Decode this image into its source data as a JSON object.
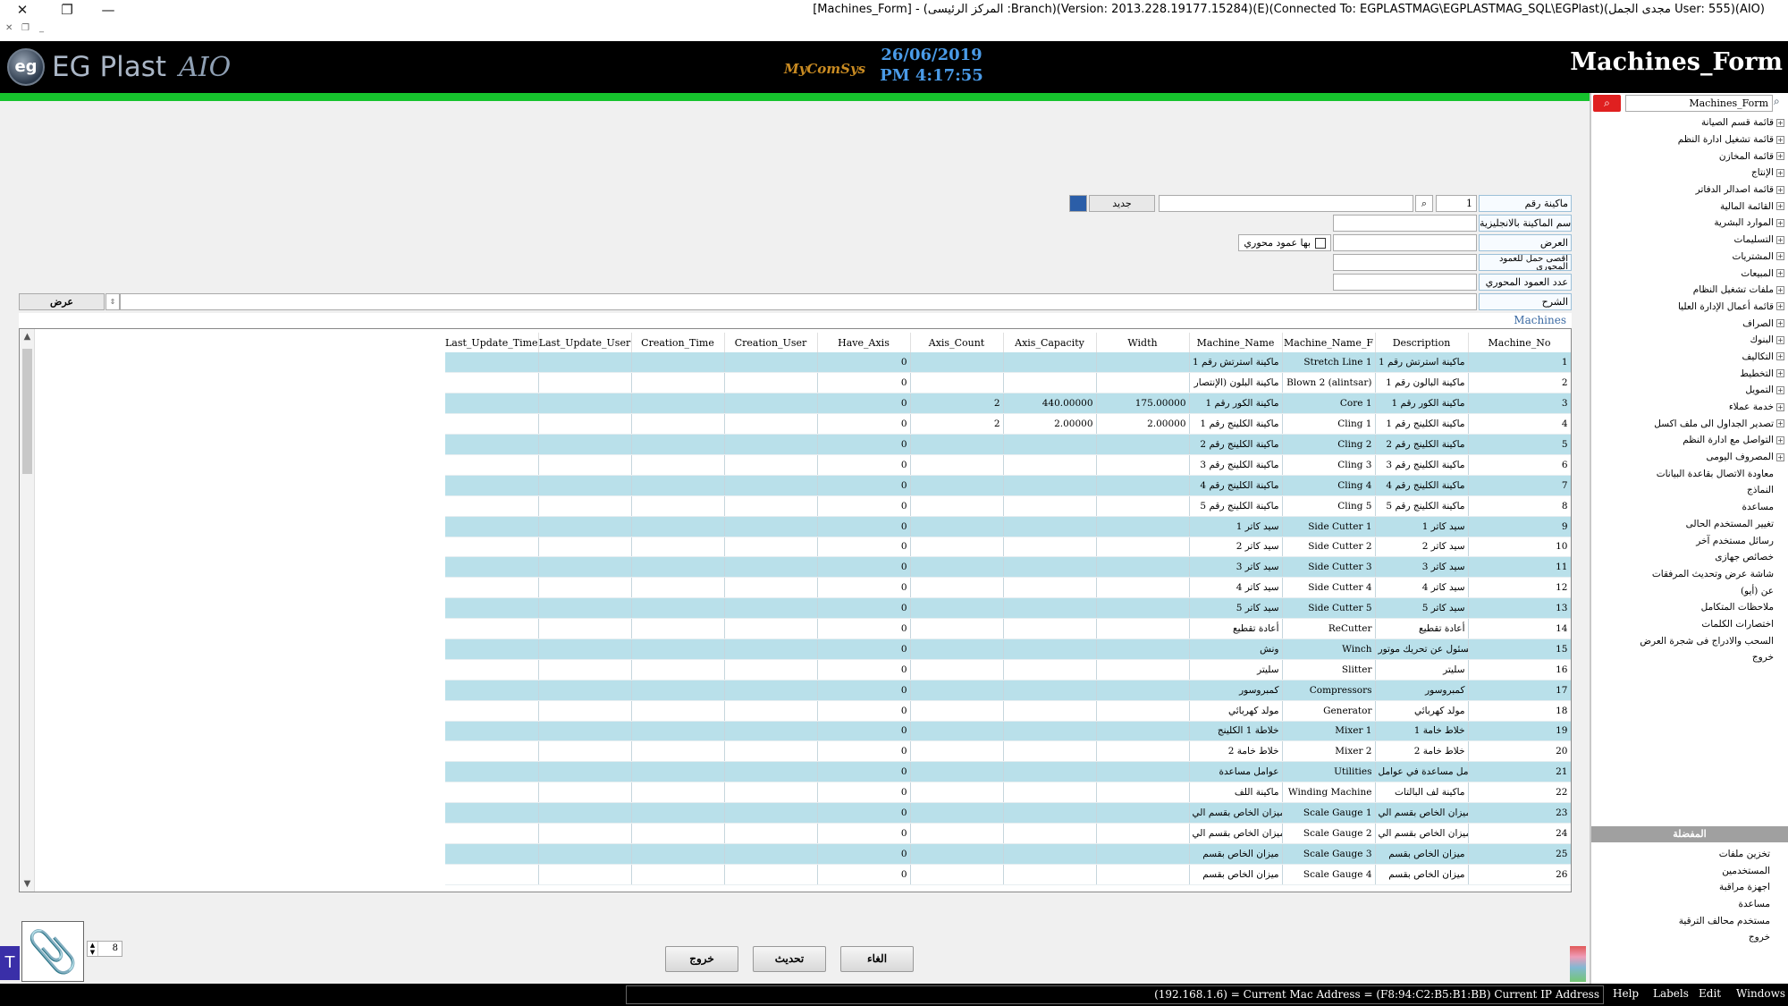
{
  "window": {
    "title": "[Machines_Form] - (المركز الرئيسى :Branch)(Version: 2013.228.19177.15284)(E)(Connected To: EGPLASTMAG\\EGPLASTMAG_SQL\\EGPlast)(مجدى الجمل User: 555)(AIO)",
    "close_glyph": "✕",
    "restore_glyph": "❐",
    "minimize_glyph": "—"
  },
  "header": {
    "logo_text": "EG Plast",
    "logo_script": "AIO",
    "brand_mid": "MyComSys",
    "date": "26/06/2019",
    "time": "PM 4:17:55",
    "form_title": "Machines_Form"
  },
  "sidebar": {
    "search_value": "Machines_Form",
    "items": [
      {
        "label": "قائمة قسم الصيانة",
        "plus": true
      },
      {
        "label": "قائمة تشغيل ادارة النظم",
        "plus": true
      },
      {
        "label": "قائمة المخازن",
        "plus": true
      },
      {
        "label": "الإنتاج",
        "plus": true
      },
      {
        "label": "قائمة اصدالر الدفاتر",
        "plus": true
      },
      {
        "label": "القائمة المالية",
        "plus": true
      },
      {
        "label": "الموارد البشرية",
        "plus": true
      },
      {
        "label": "التسليمات",
        "plus": true
      },
      {
        "label": "المشتريات",
        "plus": true
      },
      {
        "label": "المبيعات",
        "plus": true
      },
      {
        "label": "ملفات تشغيل النظام",
        "plus": true
      },
      {
        "label": "قائمة أعمال الإدارة العليا",
        "plus": true
      },
      {
        "label": "الصراف",
        "plus": true
      },
      {
        "label": "البنوك",
        "plus": true
      },
      {
        "label": "التكاليف",
        "plus": true
      },
      {
        "label": "التخطيط",
        "plus": true
      },
      {
        "label": "التمويل",
        "plus": true
      },
      {
        "label": "خدمة عملاء",
        "plus": true
      },
      {
        "label": "تصدير الجداول الى ملف اكسل",
        "plus": true
      },
      {
        "label": "التواصل مع ادارة النظم",
        "plus": true
      },
      {
        "label": "المصروف اليومى",
        "plus": true
      },
      {
        "label": "معاودة الاتصال بقاعدة البيانات",
        "plus": false
      },
      {
        "label": "النماذج",
        "plus": false
      },
      {
        "label": "مساعدة",
        "plus": false
      },
      {
        "label": "تغيير المستخدم الحالى",
        "plus": false
      },
      {
        "label": "رسائل مستخدم آخر",
        "plus": false
      },
      {
        "label": "خصائص جهازى",
        "plus": false
      },
      {
        "label": "شاشة عرض وتحديث المرفقات",
        "plus": false
      },
      {
        "label": "عن (أيو)",
        "plus": false
      },
      {
        "label": "ملاحظات المتكامل",
        "plus": false
      },
      {
        "label": "اختصارات الكلمات",
        "plus": false
      },
      {
        "label": "السحب والادراج فى شجرة العرض",
        "plus": false
      },
      {
        "label": "خروج",
        "plus": false
      }
    ],
    "sub_header": "المفضلة",
    "sub_items": [
      "تخزين ملفات",
      "المستخدمين",
      "اجهزة مراقبة",
      "مساعدة",
      "مستخدم محالف الترقية",
      "خروج"
    ]
  },
  "form": {
    "machine_no_label": "ماكينة رقم",
    "machine_no_value": "1",
    "new_button": "جديد",
    "name_en_label": "اسم الماكينة بالانجليزية",
    "width_label": "العرض",
    "has_axis_label": "بها عمود محوري",
    "axis_capacity_label": "أقصى حمل للعمود المحورى",
    "axis_count_label": "عدد العمود المحوري",
    "description_label": "الشرح",
    "view_button": "عرض"
  },
  "grid": {
    "title": "Machines",
    "columns": [
      "Last_Update_Time",
      "Last_Update_User",
      "Creation_Time",
      "Creation_User",
      "Have_Axis",
      "Axis_Count",
      "Axis_Capacity",
      "Width",
      "Machine_Name",
      "Machine_Name_F",
      "Description",
      "Machine_No"
    ],
    "rows": [
      [
        "",
        "",
        "",
        "",
        "0",
        "",
        "",
        "",
        "ماكينة استرتش رقم 1",
        "Stretch Line 1",
        "ماكينة استرتش رقم 1",
        "1"
      ],
      [
        "",
        "",
        "",
        "",
        "0",
        "",
        "",
        "",
        "ماكينة البلون (الإنتصار",
        "Blown 2 (alintsar)",
        "ماكينة البالون رقم 1",
        "2"
      ],
      [
        "",
        "",
        "",
        "",
        "0",
        "2",
        "440.00000",
        "175.00000",
        "ماكينة الكور رقم 1",
        "Core 1",
        "ماكينة الكور رقم 1",
        "3"
      ],
      [
        "",
        "",
        "",
        "",
        "0",
        "2",
        "2.00000",
        "2.00000",
        "ماكينة الكلينج رقم 1",
        "Cling 1",
        "ماكينة الكلينج رقم 1",
        "4"
      ],
      [
        "",
        "",
        "",
        "",
        "0",
        "",
        "",
        "",
        "ماكينة الكلينج رقم 2",
        "Cling 2",
        "ماكينة الكلينج رقم 2",
        "5"
      ],
      [
        "",
        "",
        "",
        "",
        "0",
        "",
        "",
        "",
        "ماكينة الكلينج رقم 3",
        "Cling 3",
        "ماكينة الكلينج رقم 3",
        "6"
      ],
      [
        "",
        "",
        "",
        "",
        "0",
        "",
        "",
        "",
        "ماكينة الكلينج رقم 4",
        "Cling 4",
        "ماكينة الكلينج رقم 4",
        "7"
      ],
      [
        "",
        "",
        "",
        "",
        "0",
        "",
        "",
        "",
        "ماكينة الكلينج رقم 5",
        "Cling 5",
        "ماكينة الكلينج رقم 5",
        "8"
      ],
      [
        "",
        "",
        "",
        "",
        "0",
        "",
        "",
        "",
        "سيد كاتر 1",
        "Side Cutter 1",
        "سيد كاتر 1",
        "9"
      ],
      [
        "",
        "",
        "",
        "",
        "0",
        "",
        "",
        "",
        "سيد كاتر 2",
        "Side Cutter 2",
        "سيد كاتر 2",
        "10"
      ],
      [
        "",
        "",
        "",
        "",
        "0",
        "",
        "",
        "",
        "سيد كاتر 3",
        "Side Cutter 3",
        "سيد كاتر 3",
        "11"
      ],
      [
        "",
        "",
        "",
        "",
        "0",
        "",
        "",
        "",
        "سيد كاتر 4",
        "Side Cutter 4",
        "سيد كاتر 4",
        "12"
      ],
      [
        "",
        "",
        "",
        "",
        "0",
        "",
        "",
        "",
        "سيد كاتر 5",
        "Side Cutter 5",
        "سيد كاتر 5",
        "13"
      ],
      [
        "",
        "",
        "",
        "",
        "0",
        "",
        "",
        "",
        "أعادة تقطيع",
        "ReCutter",
        "أعادة تقطيع",
        "14"
      ],
      [
        "",
        "",
        "",
        "",
        "0",
        "",
        "",
        "",
        "ونش",
        "Winch",
        "مسئول عن تحريك موتور",
        "15"
      ],
      [
        "",
        "",
        "",
        "",
        "0",
        "",
        "",
        "",
        "سليتر",
        "Slitter",
        "سليتر",
        "16"
      ],
      [
        "",
        "",
        "",
        "",
        "0",
        "",
        "",
        "",
        "كمبروسور",
        "Compressors",
        "كمبروسور",
        "17"
      ],
      [
        "",
        "",
        "",
        "",
        "0",
        "",
        "",
        "",
        "مولد كهربائي",
        "Generator",
        "مولد كهربائي",
        "18"
      ],
      [
        "",
        "",
        "",
        "",
        "0",
        "",
        "",
        "",
        "خلاطة 1 الكلينج",
        "Mixer 1",
        "خلاط خامة 1",
        "19"
      ],
      [
        "",
        "",
        "",
        "",
        "0",
        "",
        "",
        "",
        "خلاط خامة 2",
        "Mixer 2",
        "خلاط خامة 2",
        "20"
      ],
      [
        "",
        "",
        "",
        "",
        "0",
        "",
        "",
        "",
        "عوامل مساعدة",
        "Utilities",
        "عوامل مساعدة في عوامل",
        "21"
      ],
      [
        "",
        "",
        "",
        "",
        "0",
        "",
        "",
        "",
        "ماكينة اللف",
        "Winding Machine",
        "ماكينة لف البالتات",
        "22"
      ],
      [
        "",
        "",
        "",
        "",
        "0",
        "",
        "",
        "",
        "ميزان الخاص بقسم الي",
        "Scale Gauge 1",
        "ميزان الخاص بقسم الي",
        "23"
      ],
      [
        "",
        "",
        "",
        "",
        "0",
        "",
        "",
        "",
        "ميزان الخاص بقسم الي",
        "Scale Gauge 2",
        "ميزان الخاص بقسم الي",
        "24"
      ],
      [
        "",
        "",
        "",
        "",
        "0",
        "",
        "",
        "",
        "ميزان الخاص بقسم",
        "Scale Gauge 3",
        "ميزان الخاص بقسم",
        "25"
      ],
      [
        "",
        "",
        "",
        "",
        "0",
        "",
        "",
        "",
        "ميزان الخاص بقسم",
        "Scale Gauge 4",
        "ميزان الخاص بقسم",
        "26"
      ]
    ]
  },
  "bottom": {
    "spin_value": "8",
    "exit_button": "خروج",
    "update_button": "تحديث",
    "cancel_button": "الغاء",
    "paperclip_glyph": "📎"
  },
  "statusbar": {
    "ip_text": "(192.168.1.6) = Current Mac Address = (F8:94:C2:B5:B1:BB) Current IP Address",
    "menu": [
      "Help",
      "Labels",
      "Edit",
      "Windows"
    ]
  }
}
